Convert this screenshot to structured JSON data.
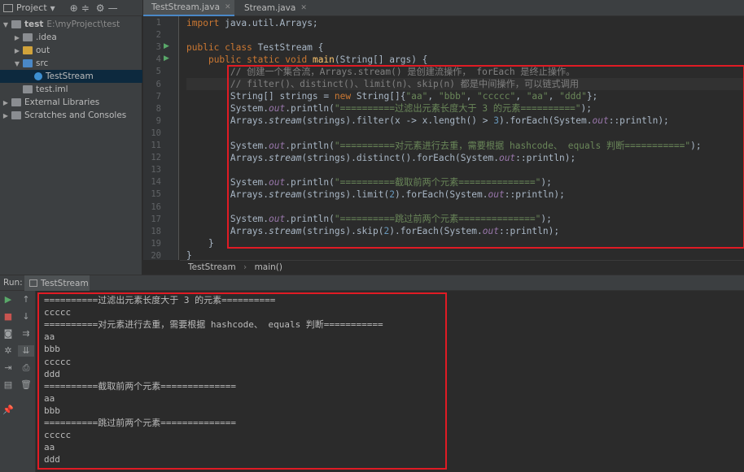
{
  "project": {
    "header": "Project",
    "tree": [
      {
        "label": "test",
        "extra": "E:\\myProject\\test",
        "arrow": "▼",
        "icon": "#8a8d91"
      },
      {
        "label": ".idea",
        "arrow": "▶",
        "icon": "#8a8d91"
      },
      {
        "label": "out",
        "arrow": "▶",
        "icon": "#d1a33b"
      },
      {
        "label": "src",
        "arrow": "▼",
        "icon": "#4a88c7"
      },
      {
        "label": "TestStream",
        "arrow": "",
        "icon": "#3d8fd1"
      },
      {
        "label": "test.iml",
        "arrow": "",
        "icon": "#8a8d91"
      },
      {
        "label": "External Libraries",
        "arrow": "▶",
        "icon": "#8a8d91"
      },
      {
        "label": "Scratches and Consoles",
        "arrow": "▶",
        "icon": "#8a8d91"
      }
    ]
  },
  "tabs": [
    {
      "label": "TestStream.java",
      "color": "#3d8fd1"
    },
    {
      "label": "Stream.java",
      "color": "#5a9e4b"
    }
  ],
  "editor": {
    "line_numbers": [
      "1",
      "2",
      "3",
      "4",
      "5",
      "6",
      "7",
      "8",
      "9",
      "10",
      "11",
      "12",
      "13",
      "14",
      "15",
      "16",
      "17",
      "18",
      "19",
      "20"
    ],
    "breadcrumb": [
      "TestStream",
      "main()"
    ]
  },
  "run": {
    "label": "Run:",
    "tab": "TestStream",
    "output": [
      "==========过滤出元素长度大于 3 的元素==========",
      "ccccc",
      "==========对元素进行去重，需要根据 hashcode、 equals 判断===========",
      "aa",
      "bbb",
      "ccccc",
      "ddd",
      "==========截取前两个元素==============",
      "aa",
      "bbb",
      "==========跳过前两个元素==============",
      "ccccc",
      "aa",
      "ddd"
    ]
  },
  "colors": {
    "highlight": "#e01b24",
    "accent": "#4a88c7"
  }
}
